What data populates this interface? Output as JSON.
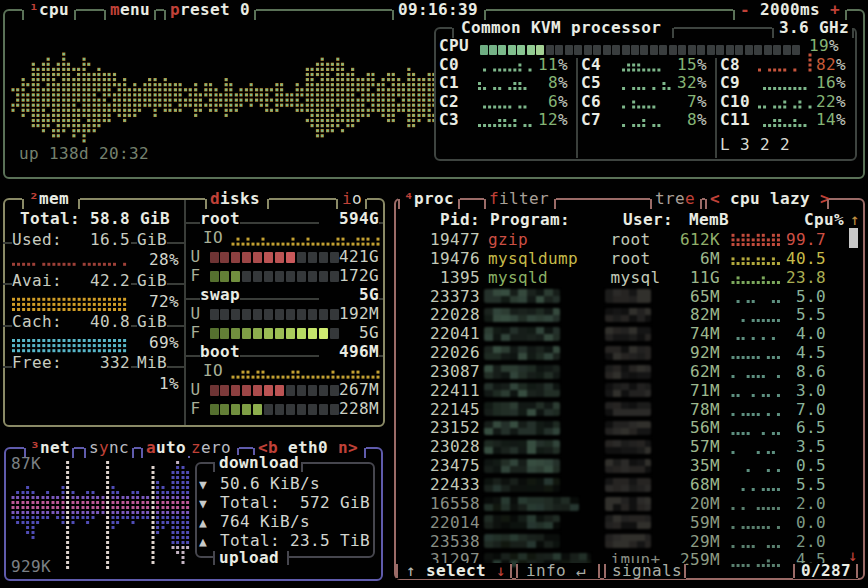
{
  "theme": {
    "bg": "#010101",
    "cpu_border": "#5a7157",
    "sub_border": "#3e4440",
    "mem_border": "#8a8a66",
    "net_border": "#5f5bac",
    "dl_border": "#46464e",
    "proc_border": "#9b6b67",
    "red": "#c04138",
    "white": "#e9ece3",
    "gray": "#9aa39b",
    "value": "#ccd1c5",
    "pct_green": "#85b475",
    "pct_red": "#c75b38"
  },
  "cpu": {
    "hotkey": "¹",
    "label": "cpu",
    "menu_hot": "m",
    "menu_rest": "enu",
    "preset_hot": "p",
    "preset_rest": "reset 0",
    "clock": "09:16:39",
    "speed_minus": "-",
    "speed": "2000ms",
    "speed_plus": "+",
    "uptime": "up 138d 20:32",
    "info_title": "Common KVM processor",
    "freq": "3.6 GHz",
    "meter_label": "CPU",
    "meter_pct": "19",
    "pct_sign": "%",
    "load": "L 3 2 2",
    "cores": [
      {
        "label": "C0",
        "pct": "11"
      },
      {
        "label": "C1",
        "pct": "8"
      },
      {
        "label": "C2",
        "pct": "6"
      },
      {
        "label": "C3",
        "pct": "12"
      },
      {
        "label": "C4",
        "pct": "15"
      },
      {
        "label": "C5",
        "pct": "32"
      },
      {
        "label": "C6",
        "pct": "7"
      },
      {
        "label": "C7",
        "pct": "8"
      },
      {
        "label": "C8",
        "pct": "82"
      },
      {
        "label": "C9",
        "pct": "16"
      },
      {
        "label": "C10",
        "pct": "22"
      },
      {
        "label": "C11",
        "pct": "14"
      }
    ]
  },
  "mem": {
    "hotkey": "²",
    "label": "mem",
    "total": "Total: 58.8 GiB",
    "stats": [
      {
        "label": "Used:",
        "value": "16.5",
        "unit": "GiB",
        "pct": "28%"
      },
      {
        "label": "Avai:",
        "value": "42.2",
        "unit": "GiB",
        "pct": "72%"
      },
      {
        "label": "Cach:",
        "value": "40.8",
        "unit": "GiB",
        "pct": "69%"
      },
      {
        "label": "Free:",
        "value": "332",
        "unit": "MiB",
        "pct": "1%"
      }
    ]
  },
  "disks": {
    "hot": "d",
    "label": "isks",
    "io_hot": "i",
    "io_label": "o",
    "rows": [
      {
        "type": "rule",
        "name": "root",
        "size": "594G"
      },
      {
        "type": "io",
        "label": "IO",
        "graph": "io1"
      },
      {
        "type": "meter",
        "label": "U",
        "value": "421G",
        "filled": 8,
        "ramp": "red"
      },
      {
        "type": "meter",
        "label": "F",
        "value": "172G",
        "filled": 3,
        "ramp": "green"
      },
      {
        "type": "rule",
        "name": "swap",
        "size": "5G"
      },
      {
        "type": "meter",
        "label": "U",
        "value": "192M",
        "filled": 0,
        "ramp": "red"
      },
      {
        "type": "meter",
        "label": "F",
        "value": "5G",
        "filled": 11,
        "ramp": "green"
      },
      {
        "type": "rule",
        "name": "boot",
        "size": "496M"
      },
      {
        "type": "io",
        "label": "IO",
        "graph": "io2"
      },
      {
        "type": "meter",
        "label": "U",
        "value": "267M",
        "filled": 7,
        "ramp": "red"
      },
      {
        "type": "meter",
        "label": "F",
        "value": "228M",
        "filled": 5,
        "ramp": "green"
      }
    ]
  },
  "net": {
    "hotkey": "³",
    "label": "net",
    "sync_pre": "s",
    "sync_hot": "y",
    "sync_post": "nc",
    "auto_hot": "a",
    "auto_rest": "uto",
    "zero_hot": "z",
    "zero_rest": "ero",
    "iface_l": "<b",
    "iface": "eth0",
    "iface_r": "n>",
    "scale_top": "87K",
    "scale_bottom": "929K",
    "box_title": "download",
    "box_bottom": "upload",
    "rows": [
      {
        "arrow": "▼",
        "text": "50.6 KiB/s"
      },
      {
        "arrow": "▼",
        "text": "Total:  572 GiB"
      },
      {
        "arrow": "▲",
        "text": "764 KiB/s"
      },
      {
        "arrow": "▲",
        "text": "Total: 23.5 TiB"
      }
    ]
  },
  "proc": {
    "hotkey": "⁴",
    "label": "proc",
    "filter_hot": "f",
    "filter_rest": "ilter",
    "tree_pre": "tre",
    "tree_hot": "e",
    "mode_l": "<",
    "mode": "cpu lazy",
    "mode_r": ">",
    "header": {
      "pid": "Pid:",
      "program": "Program:",
      "user": "User:",
      "mem": "MemB",
      "cpu": "Cpu%",
      "sort": "↑"
    },
    "footer": {
      "up": "↑",
      "select": "select",
      "down": "↓",
      "info": "info",
      "enter": "↵",
      "signals": "signals",
      "count": "0/287",
      "scroll_down": "↓"
    },
    "rows": [
      {
        "pid": "19477",
        "program": "gzip",
        "user": "root",
        "mem": "612K",
        "cpu": "99.7",
        "cls": "r-red",
        "graph": "pg0"
      },
      {
        "pid": "19476",
        "program": "mysqldump",
        "user": "root",
        "mem": "6M",
        "cpu": "40.5",
        "cls": "r-yel",
        "graph": "pg1"
      },
      {
        "pid": "1395",
        "program": "mysqld",
        "user": "mysql",
        "mem": "11G",
        "cpu": "23.8",
        "cls": "r-grn",
        "graph": "pg2"
      },
      {
        "pid": "23373",
        "censored": true,
        "mem": "65M",
        "cpu": "5.0",
        "graph": "pg3"
      },
      {
        "pid": "22028",
        "censored": true,
        "mem": "82M",
        "cpu": "5.5",
        "graph": "pg4"
      },
      {
        "pid": "22041",
        "censored": true,
        "mem": "74M",
        "cpu": "4.0",
        "graph": "pg5"
      },
      {
        "pid": "22026",
        "censored": true,
        "mem": "92M",
        "cpu": "4.5",
        "graph": "pg6"
      },
      {
        "pid": "23087",
        "censored": true,
        "mem": "62M",
        "cpu": "8.6",
        "graph": "pg7"
      },
      {
        "pid": "22411",
        "censored": true,
        "mem": "71M",
        "cpu": "3.0",
        "graph": "pg8"
      },
      {
        "pid": "22145",
        "censored": true,
        "mem": "78M",
        "cpu": "7.0",
        "graph": "pg9"
      },
      {
        "pid": "23152",
        "censored": true,
        "mem": "56M",
        "cpu": "6.5",
        "graph": "pg10"
      },
      {
        "pid": "23028",
        "censored": true,
        "mem": "57M",
        "cpu": "3.5",
        "graph": "pg11"
      },
      {
        "pid": "23475",
        "censored": true,
        "mem": "35M",
        "cpu": "0.5",
        "graph": "pg12"
      },
      {
        "pid": "22433",
        "censored": true,
        "mem": "68M",
        "cpu": "5.5",
        "graph": "pg13"
      },
      {
        "pid": "16558",
        "censored": true,
        "wide": 95,
        "mem": "20M",
        "cpu": "2.0",
        "cls": "r-dim",
        "graph": "pg14"
      },
      {
        "pid": "22014",
        "censored": true,
        "mem": "59M",
        "cpu": "0.0",
        "cls": "r-dim",
        "graph": "pg15"
      },
      {
        "pid": "23538",
        "censored": true,
        "mem": "29M",
        "cpu": "2.0",
        "cls": "r-dim",
        "graph": "pg16"
      },
      {
        "pid": "31297",
        "censored": true,
        "wide": 107,
        "user": "imun+",
        "mem": "259M",
        "cpu": "4.5",
        "cls": "r-dim",
        "graph": "pg17"
      }
    ]
  },
  "chart_data": {
    "type": "area",
    "note": "btop-style braille dot graphs; values are dot-row heights per column",
    "cpu_main": {
      "up": [
        2,
        2,
        4,
        3,
        7,
        6,
        7,
        8,
        6,
        7,
        9,
        7,
        6,
        6,
        8,
        7,
        5,
        6,
        5,
        5,
        5,
        3,
        4,
        3,
        3,
        2,
        4,
        4,
        4,
        3,
        4,
        3,
        3,
        3,
        2,
        2,
        3,
        1,
        3,
        3,
        2,
        1,
        4,
        3,
        1,
        2,
        2,
        3,
        2,
        2,
        2,
        2,
        3,
        3,
        1,
        1,
        3,
        3,
        6,
        6,
        7,
        8,
        7,
        7,
        8,
        7,
        6,
        6,
        4,
        4,
        5,
        5,
        3,
        4,
        5,
        5,
        4,
        3,
        6,
        5,
        4,
        4,
        5,
        5
      ],
      "dn": [
        3,
        2,
        4,
        3,
        6,
        6,
        7,
        6,
        8,
        8,
        7,
        6,
        8,
        7,
        9,
        7,
        7,
        6,
        5,
        5,
        4,
        4,
        5,
        4,
        4,
        3,
        3,
        2,
        4,
        2,
        3,
        3,
        3,
        3,
        2,
        2,
        4,
        3,
        2,
        3,
        3,
        2,
        4,
        3,
        3,
        3,
        1,
        2,
        1,
        2,
        3,
        3,
        3,
        2,
        2,
        2,
        3,
        3,
        5,
        6,
        8,
        8,
        7,
        7,
        6,
        7,
        6,
        6,
        5,
        4,
        4,
        3,
        3,
        4,
        5,
        5,
        3,
        3,
        6,
        6,
        5,
        4,
        5,
        5
      ]
    },
    "net": {
      "up": [
        2,
        3,
        3,
        4,
        3,
        2,
        2,
        3,
        2,
        2,
        4,
        9,
        3,
        2,
        2,
        3,
        3,
        2,
        2,
        9,
        4,
        3,
        2,
        2,
        3,
        3,
        2,
        2,
        8,
        5,
        4,
        3,
        7,
        9,
        8,
        7
      ],
      "dn": [
        3,
        4,
        4,
        6,
        7,
        4,
        3,
        3,
        2,
        3,
        4,
        13,
        4,
        3,
        3,
        4,
        3,
        2,
        2,
        13,
        5,
        4,
        3,
        3,
        4,
        3,
        3,
        3,
        12,
        6,
        5,
        4,
        9,
        10,
        12,
        9
      ],
      "pale": [
        11,
        19,
        28
      ]
    },
    "mem_used": [
      1,
      1,
      1,
      1,
      1,
      0,
      1,
      1,
      1,
      1,
      1,
      1,
      1,
      0,
      1,
      1,
      1,
      1,
      1,
      1,
      1,
      0,
      1
    ],
    "mem_avai": 3,
    "mem_cach": 3,
    "io1": [
      1,
      2,
      1,
      2,
      1,
      1,
      2,
      1,
      1,
      1,
      1,
      1,
      2,
      1,
      1,
      2,
      1,
      1,
      1,
      1,
      1,
      2,
      2,
      1,
      1,
      2,
      2,
      2,
      1,
      2
    ],
    "io2": [
      1,
      1,
      2,
      2,
      1,
      2,
      2,
      1,
      1,
      1,
      1,
      1,
      2,
      2,
      1,
      1,
      1,
      1,
      1,
      1,
      2,
      1,
      1,
      1,
      2,
      2,
      1,
      1,
      1,
      2
    ],
    "cores": [
      [
        0,
        1,
        0,
        1,
        1,
        1,
        1,
        1,
        2,
        0,
        1,
        0
      ],
      [
        2,
        1,
        0,
        1,
        1,
        0,
        1,
        2,
        2,
        1,
        0,
        0
      ],
      [
        0,
        1,
        1,
        1,
        1,
        1,
        1,
        0,
        1,
        1,
        0,
        0
      ],
      [
        1,
        1,
        1,
        1,
        2,
        2,
        1,
        2,
        0,
        1,
        1,
        0
      ],
      [
        0,
        1,
        2,
        2,
        2,
        1,
        1,
        1,
        1,
        0,
        0,
        0
      ],
      [
        0,
        1,
        0,
        1,
        1,
        1,
        0,
        1,
        0,
        2,
        1,
        0
      ],
      [
        0,
        1,
        0,
        2,
        1,
        1,
        1,
        1,
        0,
        0,
        0,
        0
      ],
      [
        0,
        1,
        0,
        1,
        1,
        2,
        0,
        1,
        1,
        0,
        0,
        0
      ],
      [
        1,
        0,
        1,
        1,
        1,
        1,
        0,
        1,
        0,
        0,
        4,
        0
      ],
      [
        0,
        1,
        1,
        1,
        1,
        1,
        1,
        1,
        1,
        1,
        0,
        0
      ],
      [
        1,
        1,
        0,
        1,
        1,
        2,
        0,
        1,
        2,
        0,
        1,
        0
      ],
      [
        0,
        1,
        1,
        2,
        2,
        1,
        1,
        2,
        1,
        1,
        0,
        0
      ]
    ],
    "pgraphs": {
      "pg0": [
        3,
        2,
        3,
        3,
        2,
        3,
        3,
        2,
        3,
        3
      ],
      "pg1": [
        2,
        1,
        2,
        2,
        1,
        2,
        2,
        1,
        2,
        1
      ],
      "pg2": [
        1,
        2,
        1,
        1,
        1,
        1,
        2,
        1,
        1,
        1
      ],
      "pg3": [
        0,
        1,
        0,
        1,
        1,
        0,
        0,
        0,
        1,
        1
      ],
      "pg4": [
        0,
        0,
        1,
        0,
        1,
        1,
        1,
        1,
        1,
        1
      ],
      "pg5": [
        0,
        1,
        1,
        0,
        1,
        0,
        1,
        0,
        1,
        0
      ],
      "pg6": [
        1,
        1,
        1,
        1,
        1,
        1,
        0,
        1,
        1,
        1
      ],
      "pg7": [
        1,
        0,
        0,
        1,
        1,
        1,
        1,
        0,
        0,
        1
      ],
      "pg8": [
        1,
        1,
        0,
        0,
        1,
        0,
        1,
        1,
        0,
        1
      ],
      "pg9": [
        1,
        0,
        1,
        1,
        1,
        1,
        0,
        1,
        0,
        1
      ],
      "pg10": [
        1,
        1,
        1,
        1,
        0,
        0,
        1,
        0,
        1,
        1
      ],
      "pg11": [
        1,
        0,
        0,
        0,
        0,
        1,
        0,
        1,
        1,
        0
      ],
      "pg12": [
        0,
        0,
        0,
        1,
        0,
        0,
        0,
        1,
        0,
        1
      ],
      "pg13": [
        0,
        0,
        1,
        0,
        1,
        0,
        1,
        1,
        1,
        1
      ],
      "pg14": [
        1,
        0,
        1,
        0,
        0,
        1,
        1,
        1,
        1,
        1
      ],
      "pg15": [
        1,
        0,
        1,
        1,
        1,
        1,
        1,
        1,
        0,
        1
      ],
      "pg16": [
        1,
        0,
        1,
        1,
        1,
        0,
        0,
        1,
        1,
        1
      ],
      "pg17": [
        1,
        1,
        1,
        1,
        0,
        1,
        1,
        2,
        1,
        1
      ]
    }
  }
}
